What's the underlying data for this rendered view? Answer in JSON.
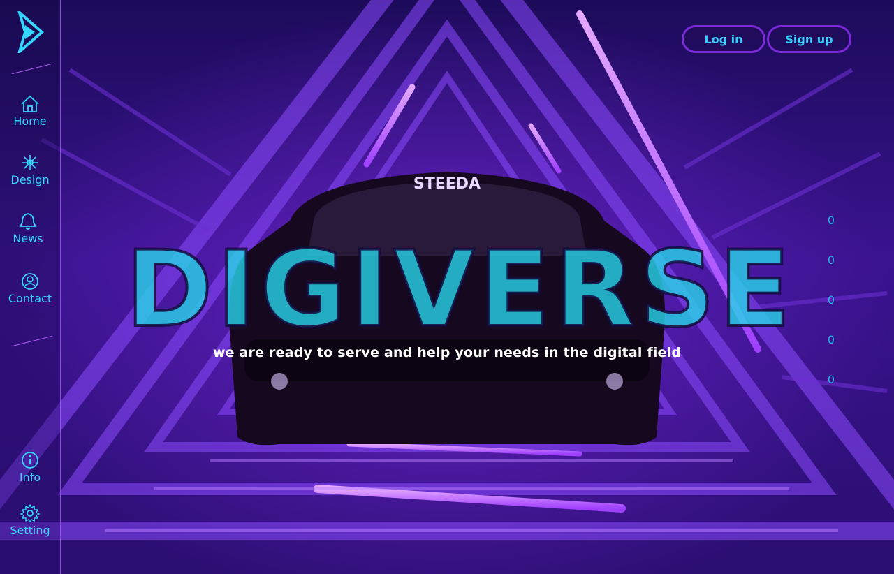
{
  "brand": {
    "name": "DIGIVERSE",
    "tagline": "we are ready to serve and help your needs in the digital field"
  },
  "header": {
    "login_label": "Log in",
    "signup_label": "Sign up"
  },
  "sidebar": {
    "items": [
      {
        "label": "Home",
        "icon": "home-icon"
      },
      {
        "label": "Design",
        "icon": "design-icon"
      },
      {
        "label": "News",
        "icon": "bell-icon"
      },
      {
        "label": "Contact",
        "icon": "contact-icon"
      },
      {
        "label": "Info",
        "icon": "info-icon"
      },
      {
        "label": "Setting",
        "icon": "gear-icon"
      }
    ]
  },
  "car": {
    "windshield_text": "STEEDA"
  },
  "slider_counters": [
    "0",
    "0",
    "0",
    "0",
    "0"
  ],
  "colors": {
    "accent": "#35d6ff",
    "border": "#7a2ad8",
    "neon": "#c95cff"
  }
}
